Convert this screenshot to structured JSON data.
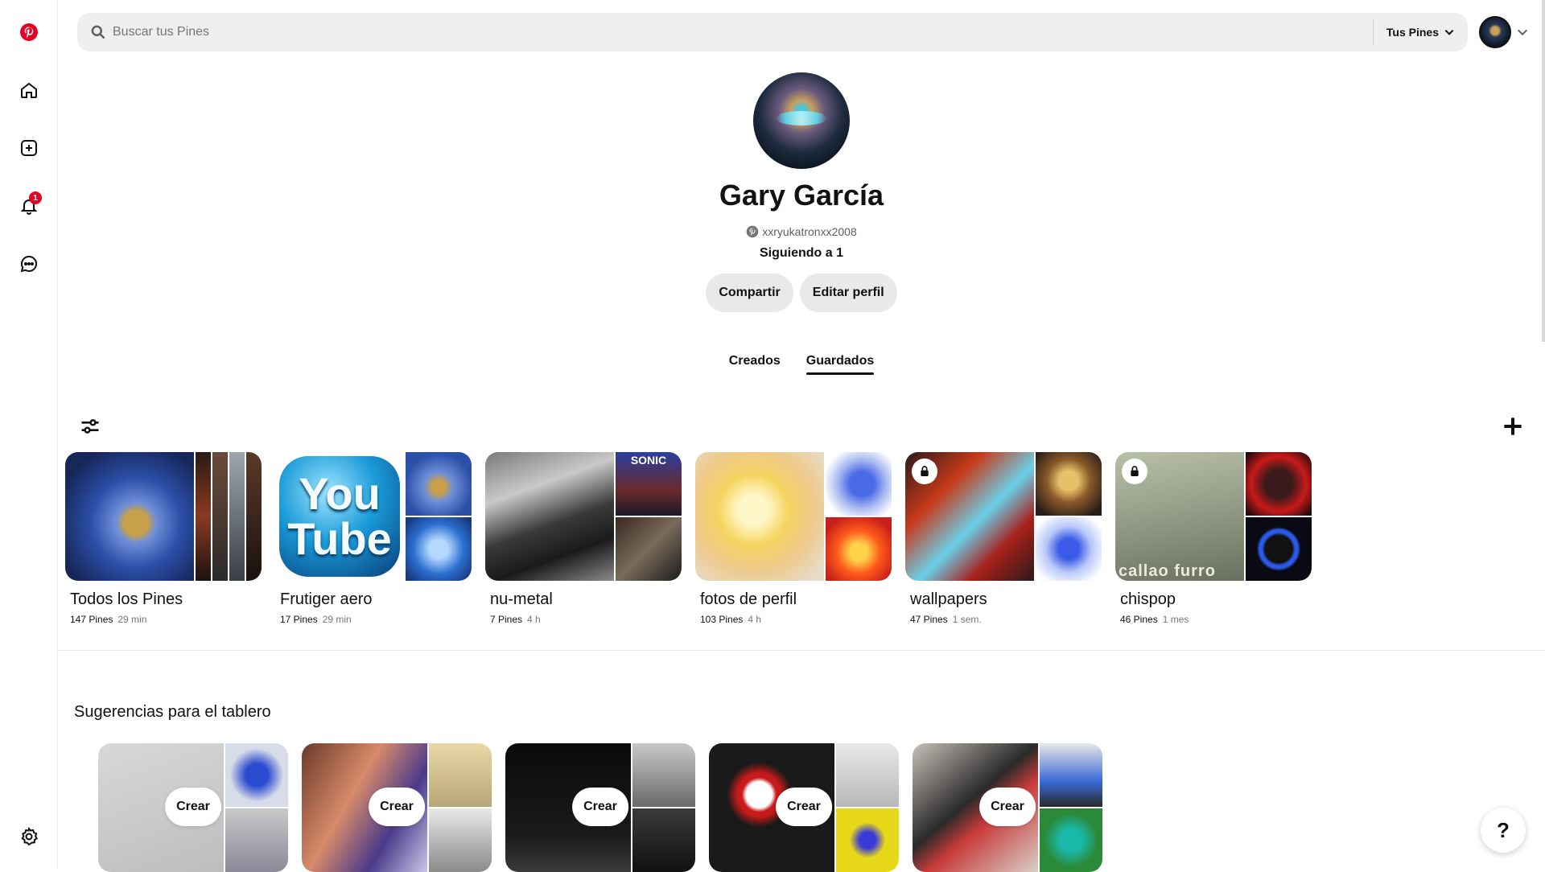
{
  "search": {
    "placeholder": "Buscar tus Pines",
    "scope_label": "Tus Pines"
  },
  "sidebar": {
    "notification_count": "1"
  },
  "profile": {
    "name": "Gary García",
    "handle": "xxryukatronxx2008",
    "following": "Siguiendo a 1",
    "share_label": "Compartir",
    "edit_label": "Editar perfil"
  },
  "tabs": [
    {
      "label": "Creados"
    },
    {
      "label": "Guardados"
    }
  ],
  "boards": [
    {
      "title": "Todos los Pines",
      "pins": "147 Pines",
      "time": "29 min",
      "private": false
    },
    {
      "title": "Frutiger aero",
      "pins": "17 Pines",
      "time": "29 min",
      "private": false
    },
    {
      "title": "nu-metal",
      "pins": "7 Pines",
      "time": "4 h",
      "private": false
    },
    {
      "title": "fotos de perfil",
      "pins": "103 Pines",
      "time": "4 h",
      "private": false
    },
    {
      "title": "wallpapers",
      "pins": "47 Pines",
      "time": "1 sem.",
      "private": true
    },
    {
      "title": "chispop",
      "pins": "46 Pines",
      "time": "1 mes",
      "private": true
    }
  ],
  "cover_texts": {
    "youtube": "You Tube",
    "sonic": "SONIC",
    "callao": "callao furro"
  },
  "suggestions": {
    "title": "Sugerencias para el tablero",
    "create_label": "Crear"
  },
  "help": {
    "label": "?"
  },
  "colors": {
    "brand": "#e60023",
    "pill": "#e9e9e9",
    "search_bg": "#efefef"
  }
}
